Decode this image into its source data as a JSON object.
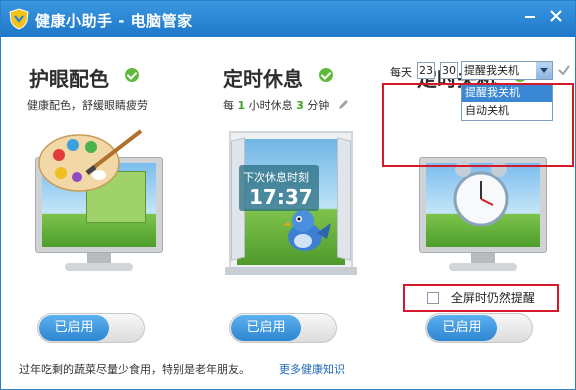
{
  "window": {
    "title": "健康小助手 - 电脑管家",
    "min_icon": "minimize-icon",
    "close_icon": "close-icon"
  },
  "eye_care": {
    "title": "护眼配色",
    "subtitle": "健康配色，舒缓眼睛疲劳",
    "toggle_label": "已启用"
  },
  "rest_timer": {
    "title": "定时休息",
    "sub_prefix": "每",
    "hours": "1",
    "hour_unit": "小时休息",
    "minutes": "3",
    "minute_unit": "分钟",
    "screen_label": "下次休息时刻",
    "screen_time": "17:37",
    "toggle_label": "已启用"
  },
  "shutdown": {
    "title": "定时关机",
    "every_day": "每天",
    "hour": "23",
    "minute": "30",
    "selected": "提醒我关机",
    "options": [
      "提醒我关机",
      "自动关机"
    ],
    "fullscreen_label": "全屏时仍然提醒",
    "toggle_label": "已启用"
  },
  "footer": {
    "tip": "过年吃剩的蔬菜尽量少食用，特别是老年朋友。",
    "link": "更多健康知识"
  },
  "colors": {
    "title_bar": "#2a86d4",
    "accent_green": "#5fb93a",
    "toggle_blue": "#2e86d2",
    "highlight_red": "#d4192b"
  }
}
